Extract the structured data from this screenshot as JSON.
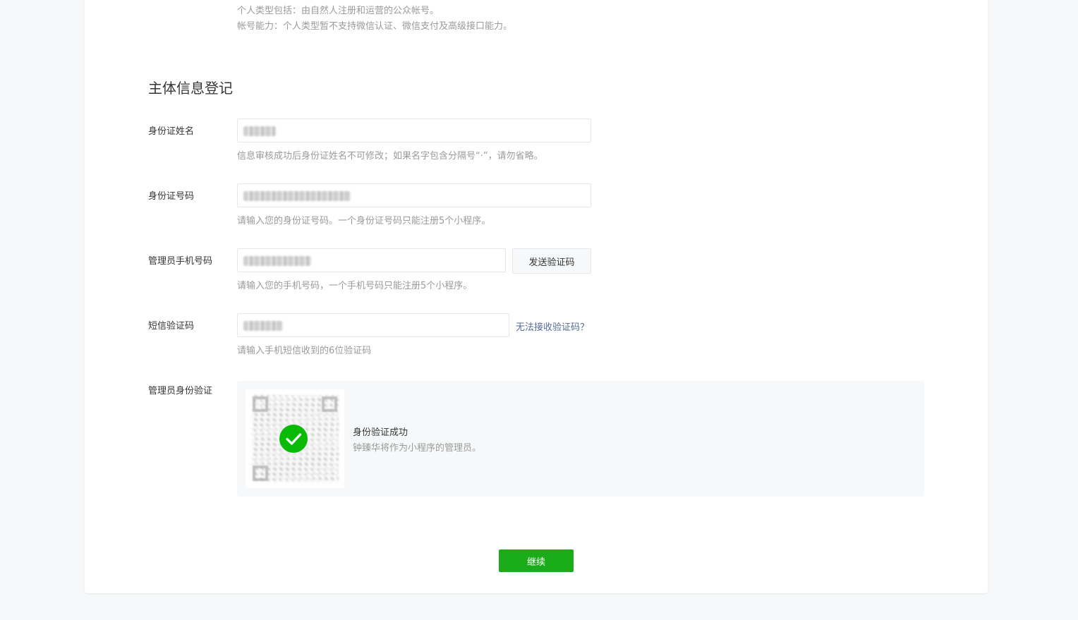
{
  "intro": {
    "line1": "个人类型包括：由自然人注册和运营的公众帐号。",
    "line2": "帐号能力：个人类型暂不支持微信认证、微信支付及高级接口能力。"
  },
  "section": {
    "title": "主体信息登记"
  },
  "form": {
    "id_name": {
      "label": "身份证姓名",
      "hint": "信息审核成功后身份证姓名不可修改；如果名字包含分隔号“·”，请勿省略。"
    },
    "id_number": {
      "label": "身份证号码",
      "hint": "请输入您的身份证号码。一个身份证号码只能注册5个小程序。"
    },
    "phone": {
      "label": "管理员手机号码",
      "send_button": "发送验证码",
      "hint": "请输入您的手机号码，一个手机号码只能注册5个小程序。"
    },
    "sms": {
      "label": "短信验证码",
      "help_link": "无法接收验证码？",
      "hint": "请输入手机短信收到的6位验证码"
    },
    "admin_verify": {
      "label": "管理员身份验证",
      "status_title": "身份验证成功",
      "status_desc": "钟臻华将作为小程序的管理员。"
    }
  },
  "actions": {
    "continue_label": "继续"
  },
  "colors": {
    "primary_green": "#1aad19",
    "check_green": "#09bb07",
    "link_blue": "#576b95",
    "page_bg": "#f6f8f9"
  }
}
